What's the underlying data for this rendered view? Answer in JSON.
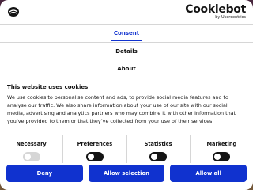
{
  "header": {
    "site_logo_icon": "site-logo-icon",
    "brand_name": "Cookiebot",
    "brand_sub": "by Usercentrics"
  },
  "tabs": [
    {
      "label": "Consent",
      "active": true
    },
    {
      "label": "Details",
      "active": false
    },
    {
      "label": "About",
      "active": false
    }
  ],
  "content": {
    "title": "This website uses cookies",
    "text": "We use cookies to personalise content and ads, to provide social media features and to analyse our traffic. We also share information about your use of our site with our social media, advertising and analytics partners who may combine it with other information that you’ve provided to them or that they’ve collected from your use of their services."
  },
  "toggles": [
    {
      "label": "Necessary",
      "state": "on-disabled"
    },
    {
      "label": "Preferences",
      "state": "off"
    },
    {
      "label": "Statistics",
      "state": "off"
    },
    {
      "label": "Marketing",
      "state": "off"
    }
  ],
  "buttons": {
    "deny": "Deny",
    "allow_selection": "Allow selection",
    "allow_all": "Allow all"
  },
  "colors": {
    "accent": "#1032cf",
    "text": "#141414",
    "divider": "#d6d6d6"
  }
}
